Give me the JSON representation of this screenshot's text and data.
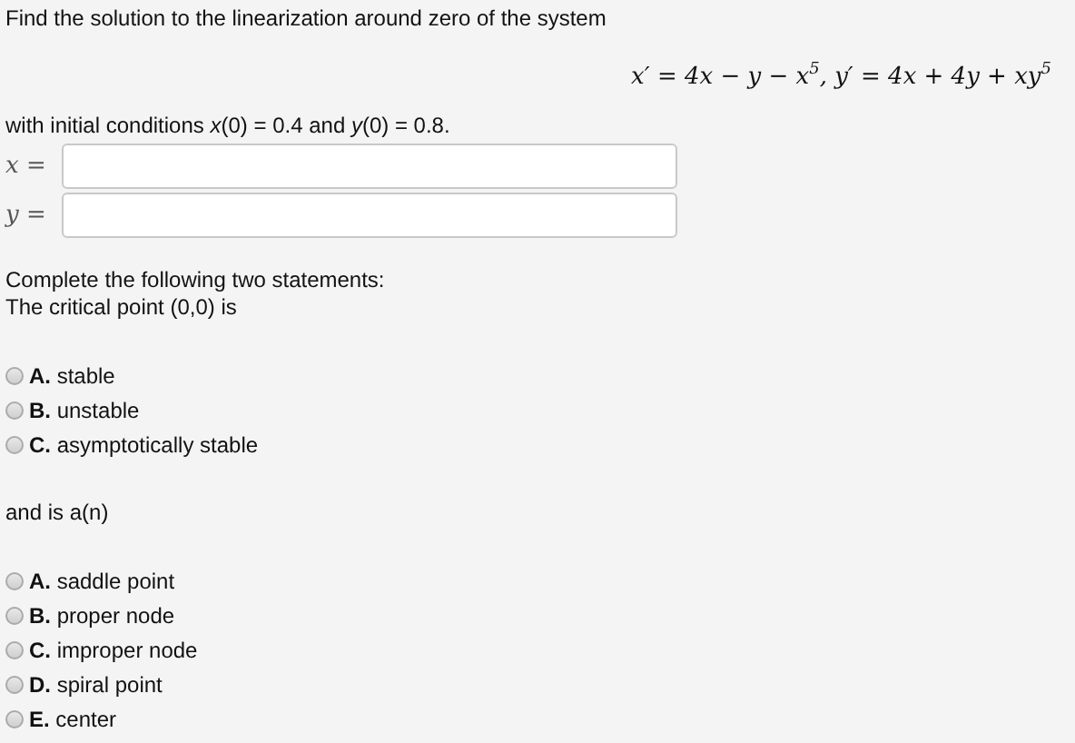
{
  "question": "Find the solution to the linearization around zero of the system",
  "equation": "x′ = 4x − y − x$^{5}$, y′ = 4x + 4y + xy$^{5}$",
  "initial_conditions": "with initial conditions *x*(0) = 0.4 and *y*(0) = 0.8.",
  "fields": [
    {
      "label": "*x* ="
    },
    {
      "label": "*y* ="
    }
  ],
  "instructions": "Complete the following two statements:",
  "prompt_1": "The critical point (0,0) is",
  "options_1": [
    {
      "text": "**A.** stable",
      "selected": false
    },
    {
      "text": "**B.** unstable",
      "selected": false
    },
    {
      "text": "**C.** asymptotically stable",
      "selected": false
    }
  ],
  "prompt_2": "and is a(n)",
  "options_2": [
    {
      "text": "**A.** saddle point",
      "selected": false
    },
    {
      "text": "**B.** proper node",
      "selected": false
    },
    {
      "text": "**C.** improper node",
      "selected": false
    },
    {
      "text": "**D.** spiral point",
      "selected": false
    },
    {
      "text": "**E.** center",
      "selected": false
    }
  ]
}
